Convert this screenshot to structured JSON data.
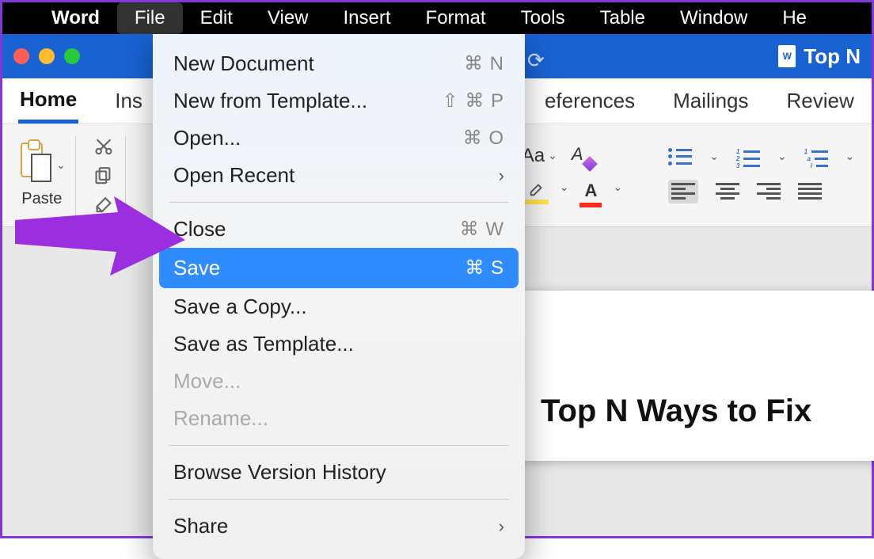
{
  "mac_menu": {
    "app": "Word",
    "items": [
      "File",
      "Edit",
      "View",
      "Insert",
      "Format",
      "Tools",
      "Table",
      "Window",
      "He"
    ],
    "active": "File"
  },
  "titlebar": {
    "doc_title": "Top N",
    "more_dots": "• • •"
  },
  "ribbon": {
    "tabs": [
      "Home",
      "Ins",
      "eferences",
      "Mailings",
      "Review"
    ],
    "active": "Home"
  },
  "toolbar": {
    "paste_label": "Paste",
    "case_label": "Aa",
    "fontcolor_letter": "A"
  },
  "file_menu": {
    "items": [
      {
        "label": "New Document",
        "shortcut": "⌘ N",
        "kind": "item"
      },
      {
        "label": "New from Template...",
        "shortcut": "⇧ ⌘ P",
        "kind": "item"
      },
      {
        "label": "Open...",
        "shortcut": "⌘ O",
        "kind": "item"
      },
      {
        "label": "Open Recent",
        "kind": "submenu"
      },
      {
        "kind": "sep"
      },
      {
        "label": "Close",
        "shortcut": "⌘ W",
        "kind": "item"
      },
      {
        "label": "Save",
        "shortcut": "⌘ S",
        "kind": "highlight"
      },
      {
        "label": "Save a Copy...",
        "kind": "item"
      },
      {
        "label": "Save as Template...",
        "kind": "item"
      },
      {
        "label": "Move...",
        "kind": "disabled"
      },
      {
        "label": "Rename...",
        "kind": "disabled"
      },
      {
        "kind": "sep"
      },
      {
        "label": "Browse Version History",
        "kind": "item"
      },
      {
        "kind": "sep"
      },
      {
        "label": "Share",
        "kind": "submenu"
      }
    ]
  },
  "document": {
    "heading": "Top N Ways to Fix"
  }
}
